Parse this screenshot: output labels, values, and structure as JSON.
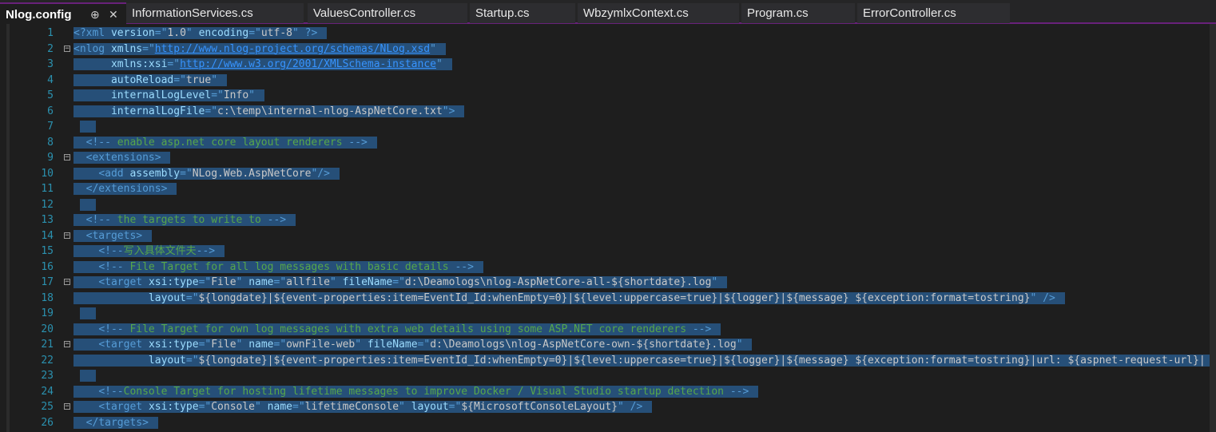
{
  "tabs": [
    {
      "label": "Nlog.config",
      "active": true
    },
    {
      "label": "InformationServices.cs",
      "active": false
    },
    {
      "label": "ValuesController.cs",
      "active": false
    },
    {
      "label": "Startup.cs",
      "active": false
    },
    {
      "label": "WbzymlxContext.cs",
      "active": false
    },
    {
      "label": "Program.cs",
      "active": false
    },
    {
      "label": "ErrorController.cs",
      "active": false
    }
  ],
  "pin_glyph": "⊕",
  "close_glyph": "✕",
  "line_numbers": [
    "1",
    "2",
    "3",
    "4",
    "5",
    "6",
    "7",
    "8",
    "9",
    "10",
    "11",
    "12",
    "13",
    "14",
    "15",
    "16",
    "17",
    "18",
    "19",
    "20",
    "21",
    "22",
    "23",
    "24",
    "25",
    "26"
  ],
  "code_lines": [
    "<?xml version=\"1.0\" encoding=\"utf-8\" ?>",
    "<nlog xmlns=\"http://www.nlog-project.org/schemas/NLog.xsd\"",
    "      xmlns:xsi=\"http://www.w3.org/2001/XMLSchema-instance\"",
    "      autoReload=\"true\"",
    "      internalLogLevel=\"Info\"",
    "      internalLogFile=\"c:\\temp\\internal-nlog-AspNetCore.txt\">",
    "",
    "  <!-- enable asp.net core layout renderers -->",
    "  <extensions>",
    "    <add assembly=\"NLog.Web.AspNetCore\"/>",
    "  </extensions>",
    "",
    "  <!-- the targets to write to -->",
    "  <targets>",
    "    <!--写入具体文件夫-->",
    "    <!-- File Target for all log messages with basic details -->",
    "    <target xsi:type=\"File\" name=\"allfile\" fileName=\"d:\\Deamologs\\nlog-AspNetCore-all-${shortdate}.log\"",
    "            layout=\"${longdate}|${event-properties:item=EventId_Id:whenEmpty=0}|${level:uppercase=true}|${logger}|${message} ${exception:format=tostring}\" />",
    "",
    "    <!-- File Target for own log messages with extra web details using some ASP.NET core renderers -->",
    "    <target xsi:type=\"File\" name=\"ownFile-web\" fileName=\"d:\\Deamologs\\nlog-AspNetCore-own-${shortdate}.log\"",
    "            layout=\"${longdate}|${event-properties:item=EventId_Id:whenEmpty=0}|${level:uppercase=true}|${logger}|${message} ${exception:format=tostring}|url: ${aspnet-request-url}|",
    "",
    "    <!--Console Target for hosting lifetime messages to improve Docker / Visual Studio startup detection -->",
    "    <target xsi:type=\"Console\" name=\"lifetimeConsole\" layout=\"${MicrosoftConsoleLayout}\" />",
    "  </targets>"
  ],
  "fold_lines": [
    "2",
    "9",
    "14",
    "17",
    "21",
    "25"
  ],
  "colors": {
    "tag": "#569cd6",
    "attr": "#9cdcfe",
    "value": "#c8c8c8",
    "quote": "#c8c8c8",
    "comment": "#57a64a",
    "url": "#3794ff",
    "selection": "#264f78",
    "line_number": "#2b91af",
    "accent": "#68217a"
  }
}
